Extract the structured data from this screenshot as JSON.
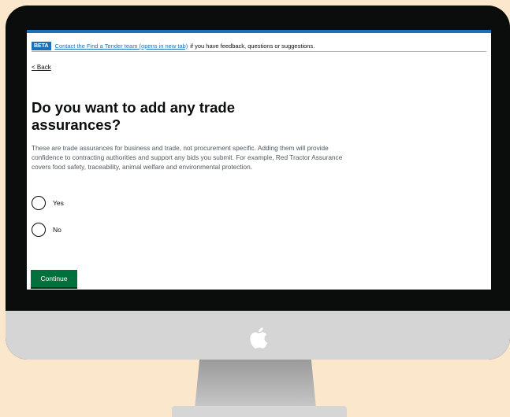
{
  "phase_banner": {
    "tag": "BETA",
    "link_text": "Contact the Find a Tender team (opens in new tab)",
    "text": "if you have feedback, questions or suggestions."
  },
  "back_link": "Back",
  "back_chevron": "<",
  "heading": "Do you want to add any trade assurances?",
  "hint": "These are trade assurances for business and trade, not procurement specific. Adding them will provide confidence to contracting authorities and support any bids you submit. For example, Red Tractor Assurance covers food safety, traceability, animal welfare and environmental protection.",
  "options": [
    {
      "label": "Yes",
      "selected": false
    },
    {
      "label": "No",
      "selected": false
    }
  ],
  "continue_label": "Continue",
  "colors": {
    "background": "#fbe7cc",
    "brand_blue": "#1d70b8",
    "button_green": "#00703c",
    "text": "#0b0c0c",
    "hint_text": "#505a5f"
  },
  "icons": {
    "logo": "apple-logo-icon",
    "back": "chevron-left-icon"
  }
}
